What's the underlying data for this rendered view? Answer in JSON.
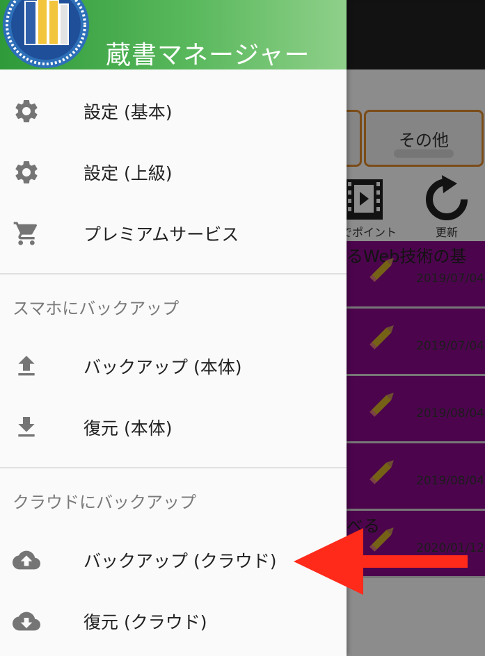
{
  "background_app": {
    "tabs": {
      "other_label": "その他"
    },
    "toolbar": {
      "point_label": "でポイント",
      "refresh_label": "更新"
    },
    "book_rows": [
      {
        "title": "るWeb技術の基",
        "date": "2019/07/04"
      },
      {
        "title": "",
        "date": "2019/07/04"
      },
      {
        "title": "",
        "date": "2019/08/04"
      },
      {
        "title": "",
        "date": "2019/08/04"
      },
      {
        "title": "べる",
        "date": "2020/01/12"
      }
    ]
  },
  "drawer": {
    "app_title": "蔵書マネージャー",
    "items": [
      {
        "label": "設定 (基本)",
        "icon": "gear-icon"
      },
      {
        "label": "設定 (上級)",
        "icon": "gear-icon"
      },
      {
        "label": "プレミアムサービス",
        "icon": "cart-icon"
      }
    ],
    "section_phone": {
      "header": "スマホにバックアップ",
      "items": [
        {
          "label": "バックアップ (本体)",
          "icon": "upload-icon"
        },
        {
          "label": "復元 (本体)",
          "icon": "download-icon"
        }
      ]
    },
    "section_cloud": {
      "header": "クラウドにバックアップ",
      "items": [
        {
          "label": "バックアップ (クラウド)",
          "icon": "cloud-upload-icon"
        },
        {
          "label": "復元 (クラウド)",
          "icon": "cloud-download-icon"
        }
      ]
    }
  },
  "colors": {
    "header_green": "#4caf50",
    "row_purple": "#8b0a8c",
    "annotation_red": "#ff2a1a",
    "button_border": "#e08a2c"
  }
}
